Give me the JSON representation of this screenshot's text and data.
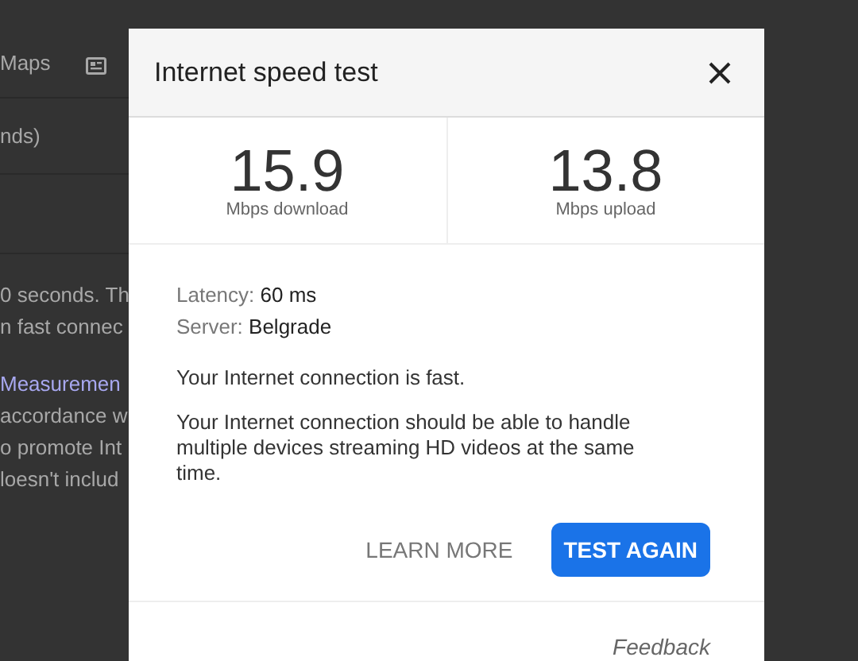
{
  "background_page": {
    "tab": "Maps",
    "caption": "nds)",
    "paragraphs": [
      {
        "lines": [
          {
            "text": "0 seconds. Th",
            "kind": "text"
          },
          {
            "text": "n fast connec",
            "kind": "text"
          }
        ]
      },
      {
        "lines": [
          {
            "text": "Measuremen",
            "kind": "link"
          },
          {
            "text": "accordance w",
            "kind": "text"
          },
          {
            "text": "o promote Int",
            "kind": "text"
          },
          {
            "text": "loesn't includ",
            "kind": "text"
          }
        ]
      }
    ]
  },
  "dialog": {
    "title": "Internet speed test",
    "results": [
      {
        "value": "15.9",
        "unit": "Mbps download"
      },
      {
        "value": "13.8",
        "unit": "Mbps upload"
      }
    ],
    "details": [
      {
        "label": "Latency:",
        "value": "60 ms"
      },
      {
        "label": "Server:",
        "value": "Belgrade"
      }
    ],
    "verdict": "Your Internet connection is fast.",
    "explanation": "Your Internet connection should be able to handle multiple devices streaming HD videos at the same time.",
    "buttons": [
      {
        "label": "LEARN MORE",
        "kind": "text"
      },
      {
        "label": "TEST AGAIN",
        "kind": "primary"
      }
    ],
    "feedback": "Feedback"
  }
}
